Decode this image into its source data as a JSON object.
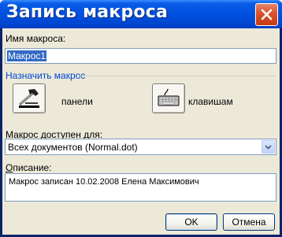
{
  "window": {
    "title": "Запись макроса"
  },
  "macro_name": {
    "label": "Имя макроса:",
    "value": "Макрос1"
  },
  "assign": {
    "title": "Назначить макрос",
    "toolbar_label": "панели",
    "keyboard_label": "клавишам"
  },
  "available_for": {
    "label": "Макрос доступен для:",
    "value": "Всех документов (Normal.dot)"
  },
  "description": {
    "label": "Описание:",
    "value": "Макрос записан 10.02.2008 Елена Максимович"
  },
  "buttons": {
    "ok": "OK",
    "cancel": "Отмена"
  }
}
